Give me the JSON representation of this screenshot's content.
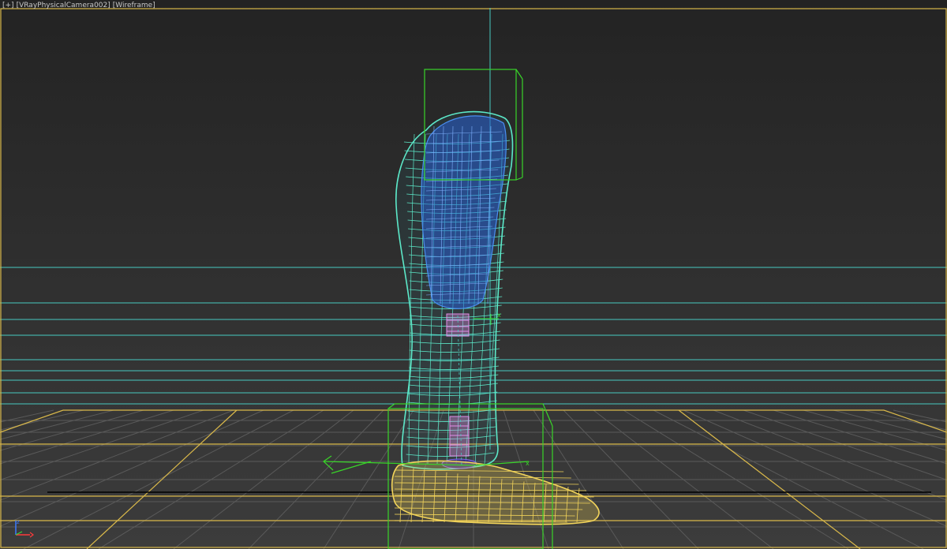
{
  "viewport": {
    "menu_label": "[+]",
    "view_label": "[VRayPhysicalCamera002]",
    "shading_label": "[Wireframe]"
  },
  "colors": {
    "background_top": "#232323",
    "background_bottom": "#3c3c3c",
    "frame_yellow": "#d9b84a",
    "guide_cyan": "#47c9c0",
    "leg_wire": "#5ce8c8",
    "socket_blue": "#2f6fd8",
    "foot_wire": "#f2d45a",
    "bbox_green": "#39d429",
    "connector_pink": "#e38ee8",
    "grid_gray": "#5a5a5a"
  },
  "icons": {
    "axis_gizmo": "xyz-axis-tripod-icon"
  }
}
